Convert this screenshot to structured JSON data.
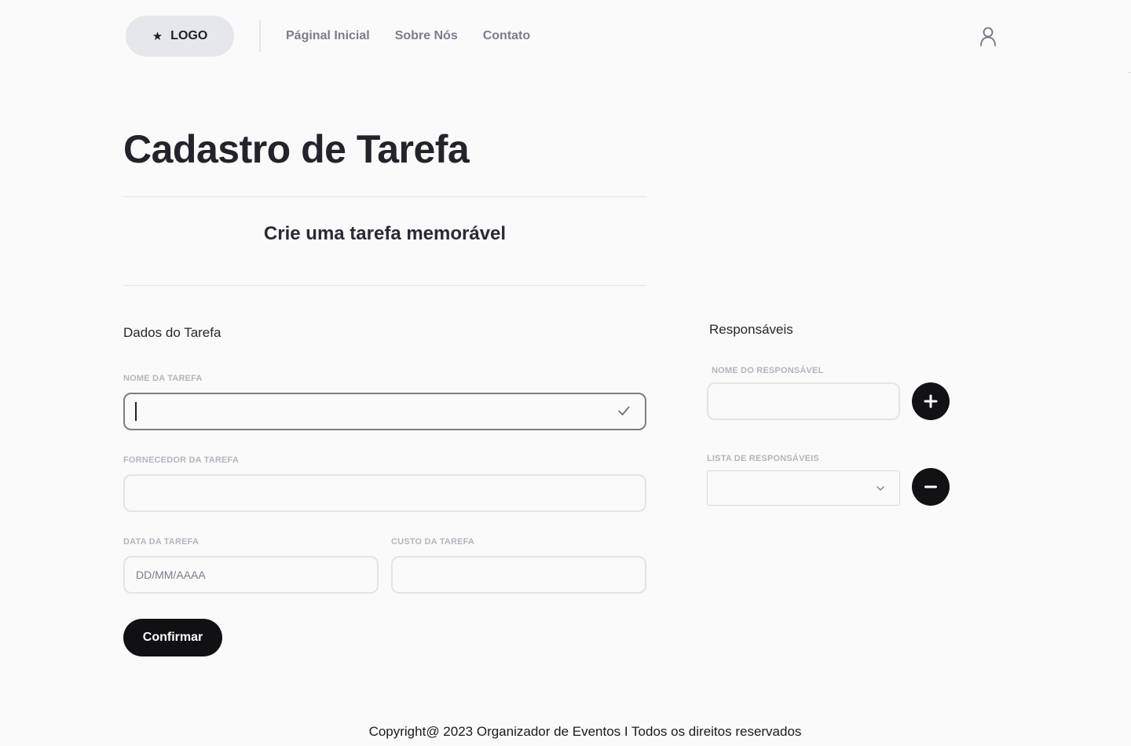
{
  "header": {
    "logo_label": "LOGO",
    "nav": [
      {
        "label": "Páginal Inicial"
      },
      {
        "label": "Sobre Nós"
      },
      {
        "label": "Contato"
      }
    ]
  },
  "page": {
    "title": "Cadastro de Tarefa",
    "subtitle": "Crie uma tarefa memorável"
  },
  "task_form": {
    "heading": "Dados do Tarefa",
    "name_label": "NOME DA TAREFA",
    "name_value": "",
    "supplier_label": "FORNECEDOR DA TAREFA",
    "supplier_value": "",
    "date_label": "DATA DA TAREFA",
    "date_placeholder": "DD/MM/AAAA",
    "cost_label": "CUSTO DA TAREFA",
    "cost_value": "",
    "confirm_label": "Confirmar"
  },
  "responsibles": {
    "heading": "Responsáveis",
    "name_label": "NOME DO RESPONSÁVEL",
    "name_value": "",
    "list_label": "LISTA DE RESPONSÁVEIS",
    "list_selected": ""
  },
  "footer": {
    "copyright": "Copyright@ 2023 Organizador de Eventos I Todos os direitos reservados"
  },
  "icons": {
    "logo": "star-icon",
    "user": "user-icon",
    "valid": "check-icon",
    "select": "chevron-down-icon",
    "add": "plus-icon",
    "remove": "minus-icon"
  },
  "colors": {
    "background": "#fafafb",
    "primary_button": "#111114",
    "muted_label": "#b3b5be",
    "nav_text": "#7b7d8a"
  }
}
